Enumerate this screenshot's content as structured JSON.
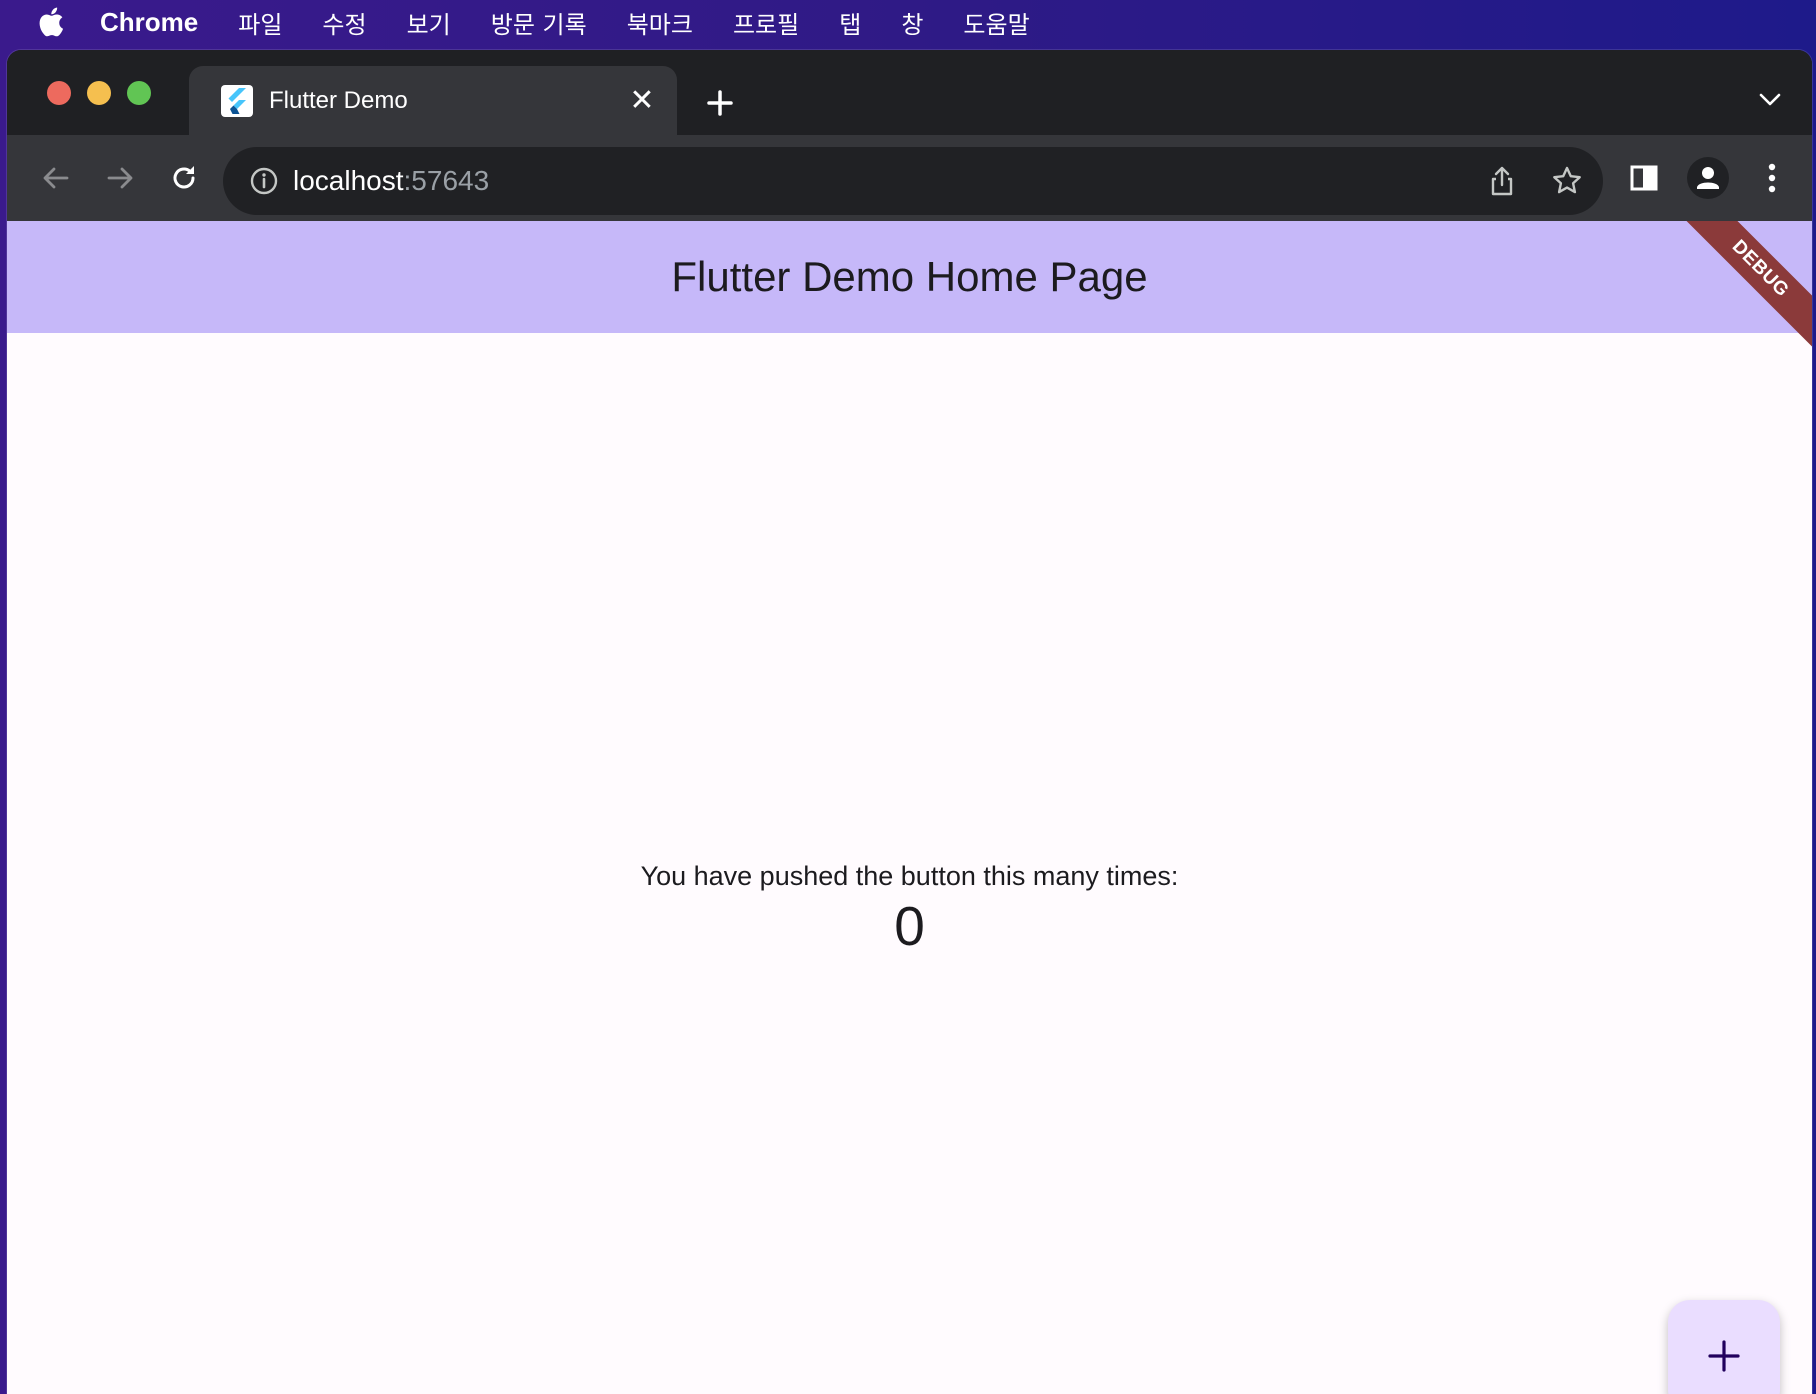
{
  "menubar": {
    "app_name": "Chrome",
    "items": [
      "파일",
      "수정",
      "보기",
      "방문 기록",
      "북마크",
      "프로필",
      "탭",
      "창",
      "도움말"
    ]
  },
  "browser": {
    "tab": {
      "title": "Flutter Demo",
      "close_glyph": "✕"
    },
    "address": {
      "host": "localhost",
      "port": ":57643"
    },
    "colors": {
      "close": "#ed6a5e",
      "minimize": "#f5bf4f",
      "zoom": "#61c554"
    }
  },
  "app": {
    "title": "Flutter Demo Home Page",
    "debug_banner": "DEBUG",
    "counter_label": "You have pushed the button this many times:",
    "counter_value": "0",
    "colors": {
      "appbar": "#c6b8f9",
      "fab": "#eaddff",
      "debug": "#8b3a3a"
    }
  },
  "icons": {
    "apple": "apple-icon",
    "back": "arrow-left-icon",
    "forward": "arrow-right-icon",
    "reload": "reload-icon",
    "info": "info-icon",
    "share": "share-icon",
    "bookmark": "star-icon",
    "sidepanel": "side-panel-icon",
    "profile": "profile-icon",
    "menu": "kebab-menu-icon",
    "fab": "plus-icon"
  }
}
